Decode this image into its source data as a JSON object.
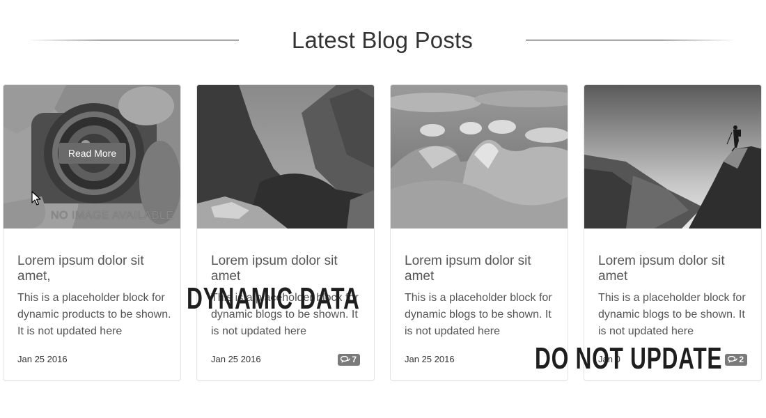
{
  "header": {
    "title": "Latest Blog Posts"
  },
  "cards": [
    {
      "title": "Lorem ipsum dolor sit amet,",
      "description": "This is a placeholder block for dynamic products to be shown. It is not updated here",
      "date": "Jan 25 2016",
      "image": "no-image-placeholder",
      "hover_button": "Read More",
      "image_text": "NO IMAGE AVAILABLE"
    },
    {
      "title": "Lorem ipsum dolor sit amet",
      "description": "This is a placeholder block for dynamic blogs to be shown. It is not updated here",
      "date": "Jan 25 2016",
      "comments": "7",
      "image": "canyon-photo"
    },
    {
      "title": "Lorem ipsum dolor sit amet",
      "description": "This is a placeholder block for dynamic blogs to be shown. It is not updated here",
      "date": "Jan 25 2016",
      "image": "desert-dunes-photo"
    },
    {
      "title": "Lorem ipsum dolor sit amet",
      "description": "This is a placeholder block for dynamic blogs to be shown. It is not updated here",
      "date": "Jan 0",
      "comments": "2",
      "image": "mountain-hiker-photo"
    }
  ],
  "overlays": {
    "dynamic": "DYNAMIC DATA",
    "no_update": "DO NOT UPDATE"
  },
  "colors": {
    "badge": "#7a7a7a",
    "button": "#6a6a6a",
    "title": "#333333"
  },
  "icons": {
    "comments": "comments-icon",
    "cursor": "mouse-cursor-icon"
  }
}
